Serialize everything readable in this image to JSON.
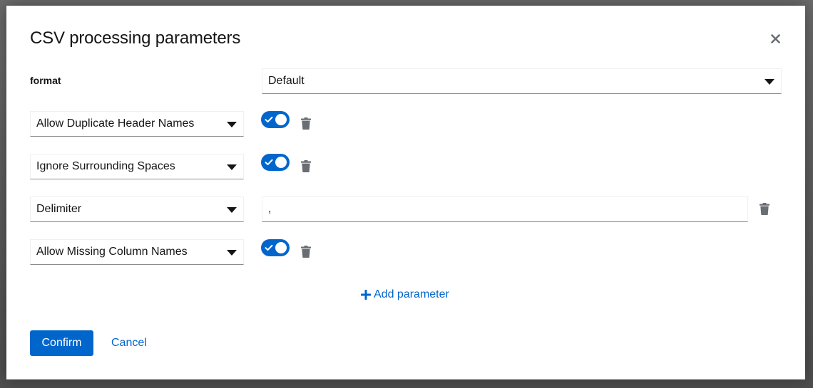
{
  "modal": {
    "title": "CSV processing parameters",
    "close_icon": "times-icon"
  },
  "format": {
    "label": "format",
    "selected": "Default"
  },
  "parameters": [
    {
      "name": "Allow Duplicate Header Names",
      "control": "toggle",
      "enabled": true
    },
    {
      "name": "Ignore Surrounding Spaces",
      "control": "toggle",
      "enabled": true
    },
    {
      "name": "Delimiter",
      "control": "text",
      "value": ","
    },
    {
      "name": "Allow Missing Column Names",
      "control": "toggle",
      "enabled": true
    }
  ],
  "add_parameter": {
    "label": "Add parameter",
    "icon": "plus-icon"
  },
  "footer": {
    "confirm_label": "Confirm",
    "cancel_label": "Cancel"
  },
  "colors": {
    "accent": "#0066cc",
    "text": "#151515",
    "icon_gray": "#6a6e73"
  }
}
